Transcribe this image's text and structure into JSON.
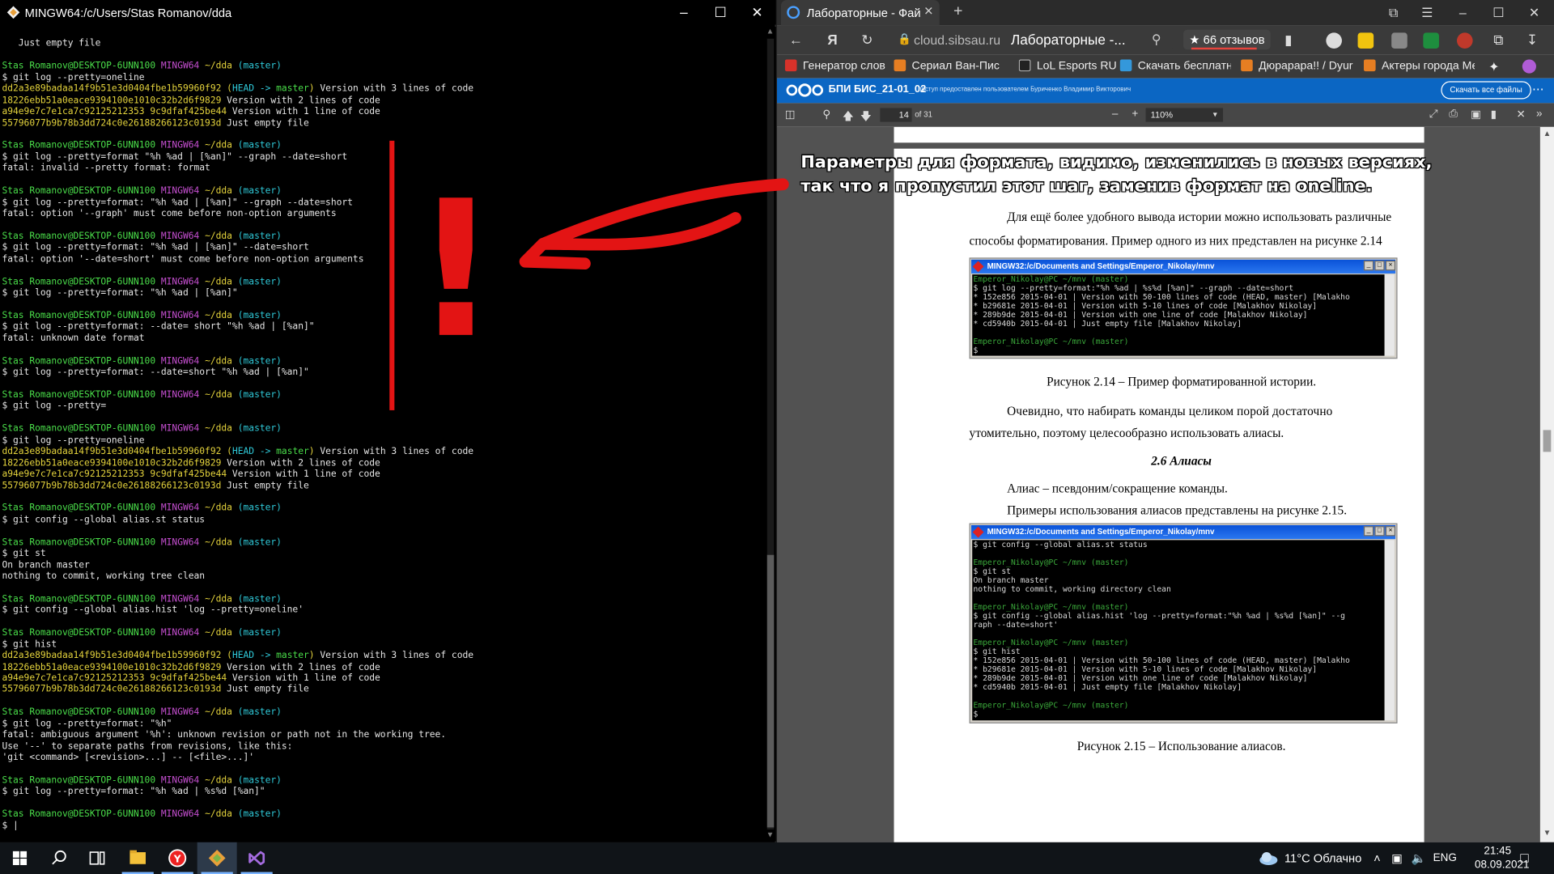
{
  "terminal": {
    "title": "MINGW64:/c/Users/Stas Romanov/dda",
    "lines": [
      [
        [
          "",
          "w"
        ]
      ],
      [
        [
          "   Just empty file",
          "w"
        ]
      ],
      [
        [
          "",
          "w"
        ]
      ],
      [
        [
          "Stas Romanov@DESKTOP-6UNN100 ",
          "g"
        ],
        [
          "MINGW64 ",
          "m"
        ],
        [
          "~/dda ",
          "y"
        ],
        [
          "(master)",
          "c"
        ]
      ],
      [
        [
          "$ git log --pretty=oneline",
          "w"
        ]
      ],
      [
        [
          "dd2a3e89badaa14f9b51e3d0404fbe1b59960f92 ",
          "y"
        ],
        [
          "(",
          "y"
        ],
        [
          "HEAD -> ",
          "c"
        ],
        [
          "master",
          "g"
        ],
        [
          ") ",
          "y"
        ],
        [
          "Version with 3 lines of code",
          "w"
        ]
      ],
      [
        [
          "18226ebb51a0eace9394100e1010c32b2d6f9829 ",
          "y"
        ],
        [
          "Version with 2 lines of code",
          "w"
        ]
      ],
      [
        [
          "a94e9e7c7e1ca7c92125212353 9c9dfaf425be44 ",
          "y"
        ],
        [
          "Version with 1 line of code",
          "w"
        ]
      ],
      [
        [
          "55796077b9b78b3dd724c0e26188266123c0193d ",
          "y"
        ],
        [
          "Just empty file",
          "w"
        ]
      ],
      [
        [
          "",
          "w"
        ]
      ],
      [
        [
          "Stas Romanov@DESKTOP-6UNN100 ",
          "g"
        ],
        [
          "MINGW64 ",
          "m"
        ],
        [
          "~/dda ",
          "y"
        ],
        [
          "(master)",
          "c"
        ]
      ],
      [
        [
          "$ git log --pretty=format \"%h %ad | [%an]\" --graph --date=short",
          "w"
        ]
      ],
      [
        [
          "fatal: invalid --pretty format: format",
          "w"
        ]
      ],
      [
        [
          "",
          "w"
        ]
      ],
      [
        [
          "Stas Romanov@DESKTOP-6UNN100 ",
          "g"
        ],
        [
          "MINGW64 ",
          "m"
        ],
        [
          "~/dda ",
          "y"
        ],
        [
          "(master)",
          "c"
        ]
      ],
      [
        [
          "$ git log --pretty=format: \"%h %ad | [%an]\" --graph --date=short",
          "w"
        ]
      ],
      [
        [
          "fatal: option '--graph' must come before non-option arguments",
          "w"
        ]
      ],
      [
        [
          "",
          "w"
        ]
      ],
      [
        [
          "Stas Romanov@DESKTOP-6UNN100 ",
          "g"
        ],
        [
          "MINGW64 ",
          "m"
        ],
        [
          "~/dda ",
          "y"
        ],
        [
          "(master)",
          "c"
        ]
      ],
      [
        [
          "$ git log --pretty=format: \"%h %ad | [%an]\" --date=short",
          "w"
        ]
      ],
      [
        [
          "fatal: option '--date=short' must come before non-option arguments",
          "w"
        ]
      ],
      [
        [
          "",
          "w"
        ]
      ],
      [
        [
          "Stas Romanov@DESKTOP-6UNN100 ",
          "g"
        ],
        [
          "MINGW64 ",
          "m"
        ],
        [
          "~/dda ",
          "y"
        ],
        [
          "(master)",
          "c"
        ]
      ],
      [
        [
          "$ git log --pretty=format: \"%h %ad | [%an]\"",
          "w"
        ]
      ],
      [
        [
          "",
          "w"
        ]
      ],
      [
        [
          "Stas Romanov@DESKTOP-6UNN100 ",
          "g"
        ],
        [
          "MINGW64 ",
          "m"
        ],
        [
          "~/dda ",
          "y"
        ],
        [
          "(master)",
          "c"
        ]
      ],
      [
        [
          "$ git log --pretty=format: --date= short \"%h %ad | [%an]\"",
          "w"
        ]
      ],
      [
        [
          "fatal: unknown date format",
          "w"
        ]
      ],
      [
        [
          "",
          "w"
        ]
      ],
      [
        [
          "Stas Romanov@DESKTOP-6UNN100 ",
          "g"
        ],
        [
          "MINGW64 ",
          "m"
        ],
        [
          "~/dda ",
          "y"
        ],
        [
          "(master)",
          "c"
        ]
      ],
      [
        [
          "$ git log --pretty=format: --date=short \"%h %ad | [%an]\"",
          "w"
        ]
      ],
      [
        [
          "",
          "w"
        ]
      ],
      [
        [
          "Stas Romanov@DESKTOP-6UNN100 ",
          "g"
        ],
        [
          "MINGW64 ",
          "m"
        ],
        [
          "~/dda ",
          "y"
        ],
        [
          "(master)",
          "c"
        ]
      ],
      [
        [
          "$ git log --pretty=",
          "w"
        ]
      ],
      [
        [
          "",
          "w"
        ]
      ],
      [
        [
          "Stas Romanov@DESKTOP-6UNN100 ",
          "g"
        ],
        [
          "MINGW64 ",
          "m"
        ],
        [
          "~/dda ",
          "y"
        ],
        [
          "(master)",
          "c"
        ]
      ],
      [
        [
          "$ git log --pretty=oneline",
          "w"
        ]
      ],
      [
        [
          "dd2a3e89badaa14f9b51e3d0404fbe1b59960f92 ",
          "y"
        ],
        [
          "(",
          "y"
        ],
        [
          "HEAD -> ",
          "c"
        ],
        [
          "master",
          "g"
        ],
        [
          ") ",
          "y"
        ],
        [
          "Version with 3 lines of code",
          "w"
        ]
      ],
      [
        [
          "18226ebb51a0eace9394100e1010c32b2d6f9829 ",
          "y"
        ],
        [
          "Version with 2 lines of code",
          "w"
        ]
      ],
      [
        [
          "a94e9e7c7e1ca7c92125212353 9c9dfaf425be44 ",
          "y"
        ],
        [
          "Version with 1 line of code",
          "w"
        ]
      ],
      [
        [
          "55796077b9b78b3dd724c0e26188266123c0193d ",
          "y"
        ],
        [
          "Just empty file",
          "w"
        ]
      ],
      [
        [
          "",
          "w"
        ]
      ],
      [
        [
          "Stas Romanov@DESKTOP-6UNN100 ",
          "g"
        ],
        [
          "MINGW64 ",
          "m"
        ],
        [
          "~/dda ",
          "y"
        ],
        [
          "(master)",
          "c"
        ]
      ],
      [
        [
          "$ git config --global alias.st status",
          "w"
        ]
      ],
      [
        [
          "",
          "w"
        ]
      ],
      [
        [
          "Stas Romanov@DESKTOP-6UNN100 ",
          "g"
        ],
        [
          "MINGW64 ",
          "m"
        ],
        [
          "~/dda ",
          "y"
        ],
        [
          "(master)",
          "c"
        ]
      ],
      [
        [
          "$ git st",
          "w"
        ]
      ],
      [
        [
          "On branch master",
          "w"
        ]
      ],
      [
        [
          "nothing to commit, working tree clean",
          "w"
        ]
      ],
      [
        [
          "",
          "w"
        ]
      ],
      [
        [
          "Stas Romanov@DESKTOP-6UNN100 ",
          "g"
        ],
        [
          "MINGW64 ",
          "m"
        ],
        [
          "~/dda ",
          "y"
        ],
        [
          "(master)",
          "c"
        ]
      ],
      [
        [
          "$ git config --global alias.hist 'log --pretty=oneline'",
          "w"
        ]
      ],
      [
        [
          "",
          "w"
        ]
      ],
      [
        [
          "Stas Romanov@DESKTOP-6UNN100 ",
          "g"
        ],
        [
          "MINGW64 ",
          "m"
        ],
        [
          "~/dda ",
          "y"
        ],
        [
          "(master)",
          "c"
        ]
      ],
      [
        [
          "$ git hist",
          "w"
        ]
      ],
      [
        [
          "dd2a3e89badaa14f9b51e3d0404fbe1b59960f92 ",
          "y"
        ],
        [
          "(",
          "y"
        ],
        [
          "HEAD -> ",
          "c"
        ],
        [
          "master",
          "g"
        ],
        [
          ") ",
          "y"
        ],
        [
          "Version with 3 lines of code",
          "w"
        ]
      ],
      [
        [
          "18226ebb51a0eace9394100e1010c32b2d6f9829 ",
          "y"
        ],
        [
          "Version with 2 lines of code",
          "w"
        ]
      ],
      [
        [
          "a94e9e7c7e1ca7c92125212353 9c9dfaf425be44 ",
          "y"
        ],
        [
          "Version with 1 line of code",
          "w"
        ]
      ],
      [
        [
          "55796077b9b78b3dd724c0e26188266123c0193d ",
          "y"
        ],
        [
          "Just empty file",
          "w"
        ]
      ],
      [
        [
          "",
          "w"
        ]
      ],
      [
        [
          "Stas Romanov@DESKTOP-6UNN100 ",
          "g"
        ],
        [
          "MINGW64 ",
          "m"
        ],
        [
          "~/dda ",
          "y"
        ],
        [
          "(master)",
          "c"
        ]
      ],
      [
        [
          "$ git log --pretty=format: \"%h\"",
          "w"
        ]
      ],
      [
        [
          "fatal: ambiguous argument '%h': unknown revision or path not in the working tree.",
          "w"
        ]
      ],
      [
        [
          "Use '--' to separate paths from revisions, like this:",
          "w"
        ]
      ],
      [
        [
          "'git <command> [<revision>...] -- [<file>...]'",
          "w"
        ]
      ],
      [
        [
          "",
          "w"
        ]
      ],
      [
        [
          "Stas Romanov@DESKTOP-6UNN100 ",
          "g"
        ],
        [
          "MINGW64 ",
          "m"
        ],
        [
          "~/dda ",
          "y"
        ],
        [
          "(master)",
          "c"
        ]
      ],
      [
        [
          "$ git log --pretty=format: \"%h %ad | %s%d [%an]\"",
          "w"
        ]
      ],
      [
        [
          "",
          "w"
        ]
      ],
      [
        [
          "Stas Romanov@DESKTOP-6UNN100 ",
          "g"
        ],
        [
          "MINGW64 ",
          "m"
        ],
        [
          "~/dda ",
          "y"
        ],
        [
          "(master)",
          "c"
        ]
      ],
      [
        [
          "$ |",
          "w"
        ]
      ]
    ]
  },
  "annotation": {
    "line1": "Параметры для формата, видимо, изменились в новых версиях,",
    "line2": "так что я пропустил этот шаг, заменив формат на oneline.",
    "exclamation": "!"
  },
  "browser": {
    "tab_title": "Лабораторные - Файлы",
    "address_host": "cloud.sibsau.ru",
    "address_page": "Лабораторные -...",
    "reviews": "★ 66 отзывов",
    "bookmarks": [
      "Генератор слов",
      "Сериал Ван-Пис С",
      "LoL Esports RU",
      "Скачать бесплатн",
      "Дюрарара!! / Dyur",
      "Актеры города Ме"
    ],
    "cloud_name": "БПИ БИС_21-01_02",
    "cloud_info": "доступ предоставлен пользователем Буриченко Владимир Викторович",
    "download_all": "Скачать все файлы",
    "pdf_page": "14",
    "pdf_of": "of 31",
    "pdf_zoom": "110%"
  },
  "doc": {
    "p1a": "Для ещё более удобного вывода истории можно использовать различные",
    "p1b": "способы форматирования. Пример одного из них представлен на рисунке 2.14",
    "fig14_title": "MINGW32:/c/Documents and Settings/Emperor_Nikolay/mnv",
    "fig14_lines": [
      "Emperor_Nikolay@PC ~/mnv (master)",
      "$ git log --pretty=format:\"%h %ad | %s%d [%an]\" --graph --date=short",
      "* 152e856 2015-04-01 | Version with 50-100 lines of code (HEAD, master) [Malakho",
      "* b29681e 2015-04-01 | Version with 5-10 lines of code [Malakhov Nikolay]",
      "* 289b9de 2015-04-01 | Version with one line of code [Malakhov Nikolay]",
      "* cd5940b 2015-04-01 | Just empty file [Malakhov Nikolay]",
      "",
      "Emperor_Nikolay@PC ~/mnv (master)",
      "$"
    ],
    "fig14_caption": "Рисунок 2.14 – Пример форматированной истории.",
    "p2a": "Очевидно,   что   набирать   команды   целиком   порой   достаточно",
    "p2b": "утомительно, поэтому целесообразно использовать алиасы.",
    "heading": "2.6 Алиасы",
    "p3": "Алиас – псевдоним/сокращение команды.",
    "p4": "Примеры использования алиасов представлены на рисунке 2.15.",
    "fig15_title": "MINGW32:/c/Documents and Settings/Emperor_Nikolay/mnv",
    "fig15_lines": [
      "$ git config --global alias.st status",
      "",
      "Emperor_Nikolay@PC ~/mnv (master)",
      "$ git st",
      "On branch master",
      "nothing to commit, working directory clean",
      "",
      "Emperor_Nikolay@PC ~/mnv (master)",
      "$ git config --global alias.hist 'log --pretty=format:\"%h %ad | %s%d [%an]\" --g",
      "raph --date=short'",
      "",
      "Emperor_Nikolay@PC ~/mnv (master)",
      "$ git hist",
      "* 152e856 2015-04-01 | Version with 50-100 lines of code (HEAD, master) [Malakho",
      "* b29681e 2015-04-01 | Version with 5-10 lines of code [Malakhov Nikolay]",
      "* 289b9de 2015-04-01 | Version with one line of code [Malakhov Nikolay]",
      "* cd5940b 2015-04-01 | Just empty file [Malakhov Nikolay]",
      "",
      "Emperor_Nikolay@PC ~/mnv (master)",
      "$"
    ],
    "fig15_caption": "Рисунок 2.15 – Использование алиасов."
  },
  "taskbar": {
    "weather": "11°C  Облачно",
    "lang": "ENG",
    "time": "21:45",
    "date": "08.09.2021"
  },
  "colors": {
    "terminal_green": "#4ade4a",
    "terminal_magenta": "#c64fd1",
    "terminal_yellow": "#e4d33c",
    "terminal_cyan": "#2fc9d8",
    "annotation_red": "#e31414",
    "cloud_blue": "#0b66c3"
  }
}
